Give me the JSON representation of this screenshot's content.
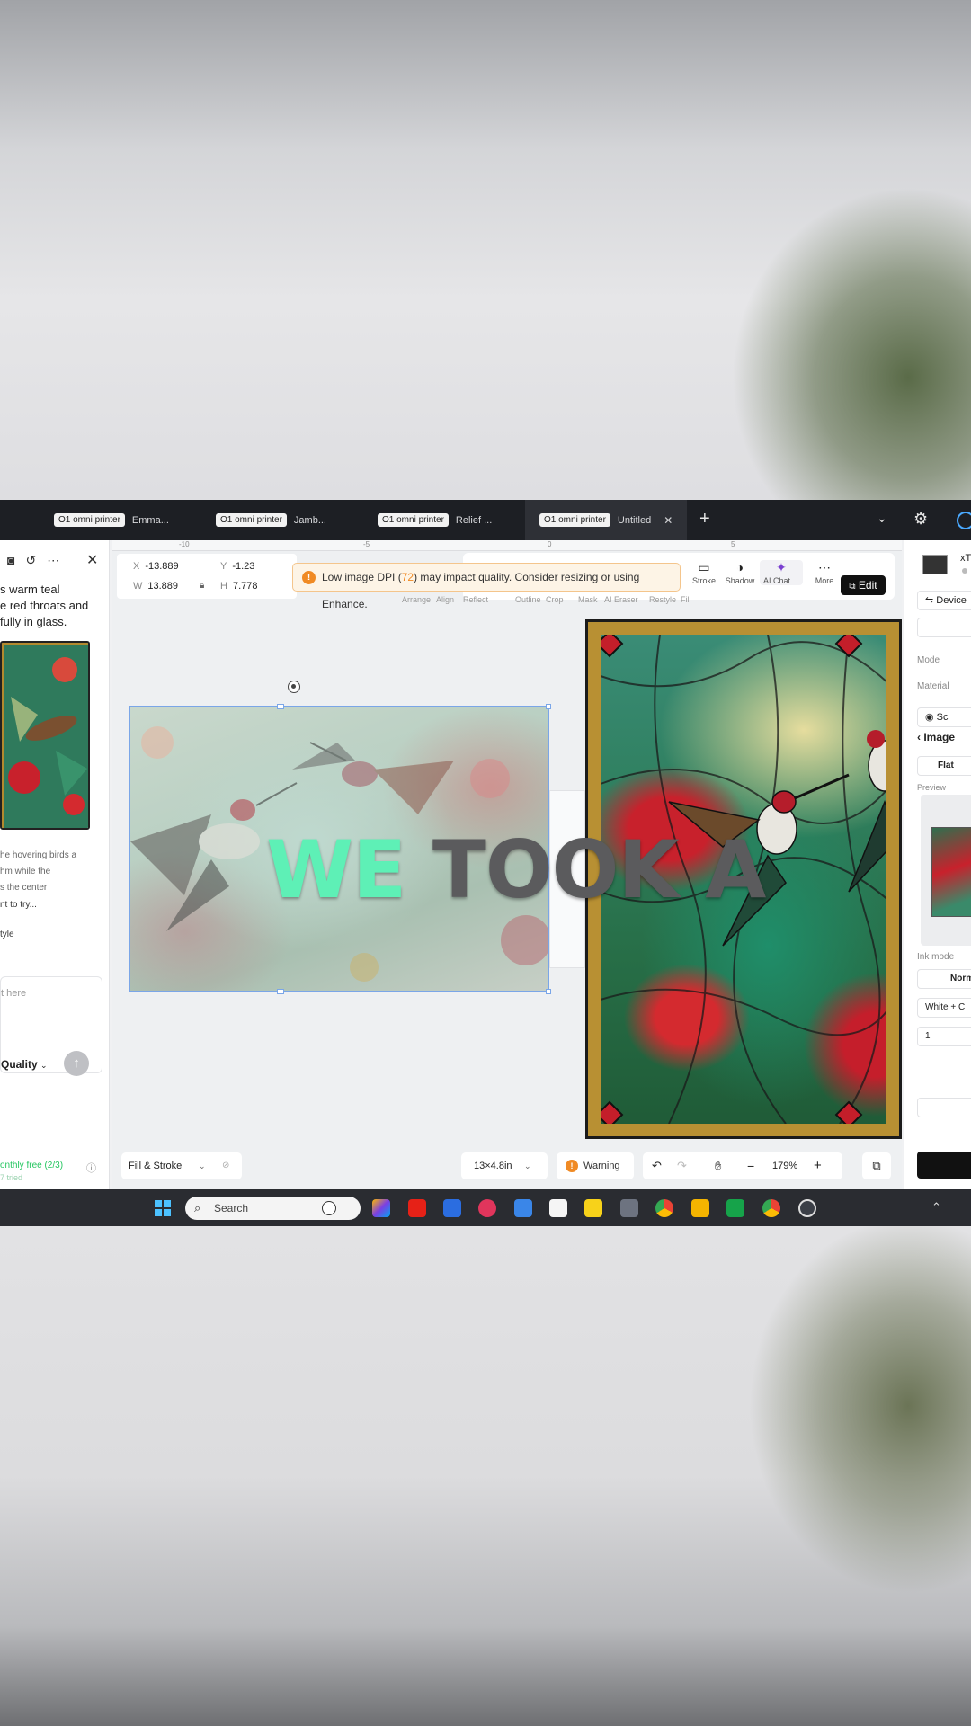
{
  "tabs": [
    {
      "badge": "O1 omni printer",
      "name": "Emma..."
    },
    {
      "badge": "O1 omni printer",
      "name": "Jamb..."
    },
    {
      "badge": "O1 omni printer",
      "name": "Relief ..."
    },
    {
      "badge": "O1 omni printer",
      "name": "Untitled",
      "active": true
    }
  ],
  "left_panel": {
    "text_lines": [
      "s warm teal",
      "e red throats and",
      "fully in glass."
    ],
    "text2_lines": [
      "he hovering birds a",
      "hm while the",
      "s the center"
    ],
    "item1": "nt to try...",
    "item2": "tyle",
    "input_placeholder": "t here",
    "quality_label": "Quality",
    "free_label": "onthly free (2/3)",
    "free_sub": "7 tried"
  },
  "ruler_ticks": [
    "-10",
    "-5",
    "0",
    "5"
  ],
  "coords": {
    "x_label": "X",
    "x": "-13.889",
    "y_label": "Y",
    "y": "-1.23",
    "w_label": "W",
    "w": "13.889",
    "h_label": "H",
    "h": "7.778"
  },
  "toast": {
    "prefix": "Low image DPI (",
    "value": "72",
    "suffix": ") may impact quality. Consider resizing or using Enhance."
  },
  "toolbar": {
    "faded": [
      "Arrange",
      "Align",
      "Reflect",
      "Outline",
      "Crop",
      "Mask",
      "AI Eraser",
      "Restyle",
      "Fill"
    ],
    "stroke": "Stroke",
    "shadow": "Shadow",
    "ai_chat": "AI Chat ...",
    "more": "More",
    "edit": "Edit"
  },
  "overlay_text": {
    "highlight": "WE",
    "rest": " TOOK A"
  },
  "bottom_bar": {
    "fill_stroke": "Fill & Stroke",
    "size": "13×4.8in",
    "warning": "Warning",
    "zoom": "179%"
  },
  "right_panel": {
    "title": "xT",
    "device": "Device",
    "mode": "Mode",
    "material": "Material",
    "sc": "Sc",
    "image": "Image",
    "flat": "Flat",
    "preview": "Preview",
    "ink_mode": "Ink mode",
    "norm": "Norm",
    "white_c": "White + C",
    "one": "1"
  },
  "taskbar": {
    "search": "Search"
  }
}
